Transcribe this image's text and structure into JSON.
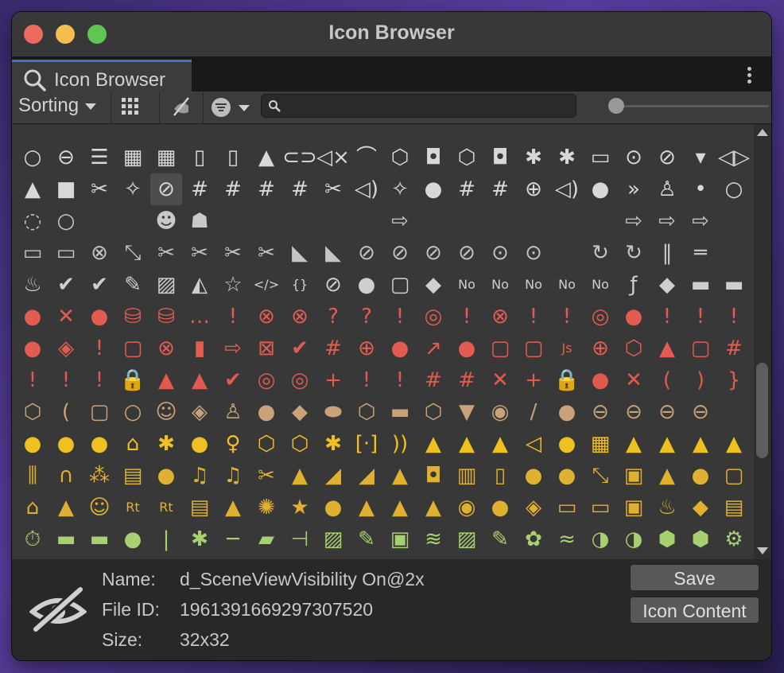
{
  "window": {
    "title": "Icon Browser",
    "tab_label": "Icon Browser"
  },
  "toolbar": {
    "sorting_label": "Sorting",
    "search_value": "",
    "zoom_fraction": 0.0
  },
  "grid": {
    "rows": [
      [
        "○",
        "⊖",
        "☰",
        "▦",
        "▦",
        "▯",
        "▯",
        "▲",
        "⊂⊃",
        "◁×",
        "⌒",
        "⬡",
        "◘",
        "⬡",
        "◘",
        "✱",
        "✱",
        "▭",
        "⊙",
        "⊘",
        "▾",
        "◁▷"
      ],
      [
        "▲",
        "■",
        "✂",
        "✧",
        "⊘",
        "#",
        "#",
        "#",
        "#",
        "✂",
        "◁)",
        "✧",
        "●",
        "#",
        "#",
        "⊕",
        "◁)",
        "●",
        "»",
        "♙",
        "•",
        "○"
      ],
      [
        "◌",
        "○",
        "",
        "",
        "☻",
        "☗",
        "",
        "",
        "",
        "",
        "",
        "⇨",
        "",
        "",
        "",
        "",
        "",
        "",
        "⇨",
        "⇨",
        "⇨",
        ""
      ],
      [
        "▭",
        "▭",
        "⊗",
        "⤡",
        "✂",
        "✂",
        "✂",
        "✂",
        "◣",
        "◣",
        "⊘",
        "⊘",
        "⊘",
        "⊘",
        "⊙",
        "⊙",
        "",
        "↻",
        "↻",
        "‖",
        "═"
      ],
      [
        "♨",
        "✔",
        "✔",
        "✎",
        "▨",
        "◭",
        "☆",
        "</>",
        "{}",
        "⊘",
        "●",
        "▢",
        "◆",
        "No",
        "No",
        "No",
        "No",
        "No",
        "ƒ",
        "◆",
        "▬",
        "▬"
      ],
      [
        "●",
        "✕",
        "●",
        "⛁",
        "⛁",
        "…",
        "!",
        "⊗",
        "⊗",
        "?",
        "?",
        "!",
        "◎",
        "!",
        "⊗",
        "!",
        "!",
        "◎",
        "●",
        "!",
        "!",
        "!"
      ],
      [
        "●",
        "◈",
        "!",
        "▢",
        "⊗",
        "▮",
        "⇨",
        "⊠",
        "✔",
        "#",
        "⊕",
        "●",
        "↗",
        "●",
        "▢",
        "▢",
        "Js",
        "⊕",
        "⬡",
        "▲",
        "▢",
        "#"
      ],
      [
        "!",
        "!",
        "!",
        "🔒",
        "▲",
        "▲",
        "✔",
        "◎",
        "◎",
        "+",
        "!",
        "!",
        "#",
        "#",
        "✕",
        "+",
        "🔒",
        "●",
        "✕",
        "(",
        ")",
        "}"
      ],
      [
        "⬡",
        "(",
        "▢",
        "○",
        "☺",
        "◈",
        "♙",
        "●",
        "◆",
        "⬬",
        "⬡",
        "▬",
        "⬡",
        "▼",
        "◉",
        "/",
        "●",
        "⊖",
        "⊖",
        "⊖",
        "⊖"
      ],
      [
        "●",
        "●",
        "●",
        "⌂",
        "✱",
        "●",
        "♀",
        "⬡",
        "⬡",
        "✱",
        "[·]",
        "))",
        "▲",
        "▲",
        "▲",
        "◁",
        "●",
        "▦",
        "▲",
        "▲",
        "▲",
        "▲"
      ],
      [
        "⫼",
        "∩",
        "⁂",
        "▤",
        "●",
        "♫",
        "♫",
        "✂",
        "▲",
        "◢",
        "◢",
        "▲",
        "◘",
        "▥",
        "▯",
        "●",
        "●",
        "⤡",
        "▣",
        "▲",
        "●",
        "▢"
      ],
      [
        "⌂",
        "▲",
        "☺",
        "Rt",
        "Rt",
        "▤",
        "▲",
        "✺",
        "★",
        "●",
        "▲",
        "▲",
        "▲",
        "◉",
        "●",
        "◈",
        "▭",
        "▭",
        "▣",
        "♨",
        "◆",
        "▤"
      ],
      [
        "⏱",
        "▬",
        "▬",
        "●",
        "|",
        "✱",
        "─",
        "▰",
        "⊣",
        "▨",
        "✎",
        "▣",
        "≋",
        "▨",
        "✎",
        "✿",
        "≈",
        "◑",
        "◑",
        "⬢",
        "⬢",
        "⚙"
      ]
    ],
    "row_colors": [
      "#d8d8d8",
      "#d8d8d8",
      "#c9c9c9",
      "#c4c4c4",
      "#cfcfcf",
      "#e35c52",
      "#e35c52",
      "#e05a4e",
      "#c9a27a",
      "#f0c020",
      "#e0b030",
      "#e0b030",
      "#a8d070"
    ]
  },
  "selected_icon": {
    "name_label": "Name:",
    "name_value": "d_SceneViewVisibility On@2x",
    "fileid_label": "File ID:",
    "fileid_value": "1961391669297307520",
    "size_label": "Size:",
    "size_value": "32x32"
  },
  "buttons": {
    "save_label": "Save",
    "icon_content_label": "Icon Content"
  },
  "colors": {
    "close": "#ed6a5e",
    "minimize": "#f5bf4f",
    "maximize": "#61c554",
    "tab_accent": "#3a79bb"
  }
}
